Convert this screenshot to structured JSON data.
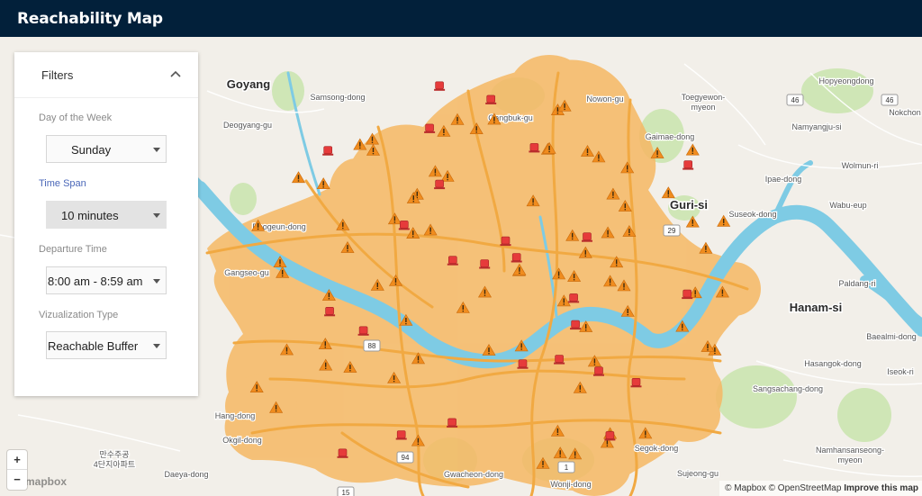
{
  "app": {
    "title": "Reachability Map"
  },
  "filters": {
    "title": "Filters",
    "day": {
      "label": "Day of the Week",
      "value": "Sunday"
    },
    "timespan": {
      "label": "Time Span",
      "value": "10 minutes"
    },
    "departure": {
      "label": "Departure Time",
      "value": "8:00 am - 8:59 am"
    },
    "viz": {
      "label": "Vizualization Type",
      "value": "Reachable Buffer"
    }
  },
  "map": {
    "colors": {
      "land": "#f2efe9",
      "river": "#7ecbe4",
      "buffer": "#f6b864",
      "road": "#f1a942",
      "park": "#cfe6b6",
      "warning": "#f08c1e",
      "station": "#e63b3b"
    },
    "places": [
      {
        "name": "Goyang",
        "major": true
      },
      {
        "name": "Samsong-dong",
        "major": false
      },
      {
        "name": "Deogyang-gu",
        "major": false
      },
      {
        "name": "Gangbuk-gu",
        "major": false
      },
      {
        "name": "Nowon-gu",
        "major": false
      },
      {
        "name": "Toegyewon-myeon",
        "major": false
      },
      {
        "name": "Hopyeongdong",
        "major": false
      },
      {
        "name": "Namyangju-si",
        "major": false
      },
      {
        "name": "Gaimae-dong",
        "major": false
      },
      {
        "name": "Wolmun-ri",
        "major": false
      },
      {
        "name": "Ipae-dong",
        "major": false
      },
      {
        "name": "Wabu-eup",
        "major": false
      },
      {
        "name": "Guri-si",
        "major": true
      },
      {
        "name": "Suseok-dong",
        "major": false
      },
      {
        "name": "Deogeun-dong",
        "major": false
      },
      {
        "name": "Gangseo-gu",
        "major": false
      },
      {
        "name": "Hanam-si",
        "major": true
      },
      {
        "name": "Paldang-ri",
        "major": false
      },
      {
        "name": "Baealmi-dong",
        "major": false
      },
      {
        "name": "Hasangok-dong",
        "major": false
      },
      {
        "name": "Iseok-ri",
        "major": false
      },
      {
        "name": "Sangsachang-dong",
        "major": false
      },
      {
        "name": "Hang-dong",
        "major": false
      },
      {
        "name": "Okgil-dong",
        "major": false
      },
      {
        "name": "Daeya-dong",
        "major": false
      },
      {
        "name": "Gwacheon-dong",
        "major": false
      },
      {
        "name": "Wonji-dong",
        "major": false
      },
      {
        "name": "Segok-dong",
        "major": false
      },
      {
        "name": "Sujeong-gu",
        "major": false
      },
      {
        "name": "Namhansanseong-myeon",
        "major": false
      },
      {
        "name": "Nokchon",
        "major": false
      },
      {
        "name": "만수주공 4단지아파트",
        "major": false
      }
    ],
    "shields": [
      "46",
      "46",
      "29",
      "88",
      "94",
      "1",
      "15"
    ],
    "markers": {
      "warning_count": 82,
      "station_count": 26
    }
  },
  "controls": {
    "zoom_in": "+",
    "zoom_out": "−"
  },
  "logo_text": "mapbox",
  "attribution": {
    "mapbox": "© Mapbox",
    "osm": "© OpenStreetMap",
    "improve": "Improve this map"
  }
}
